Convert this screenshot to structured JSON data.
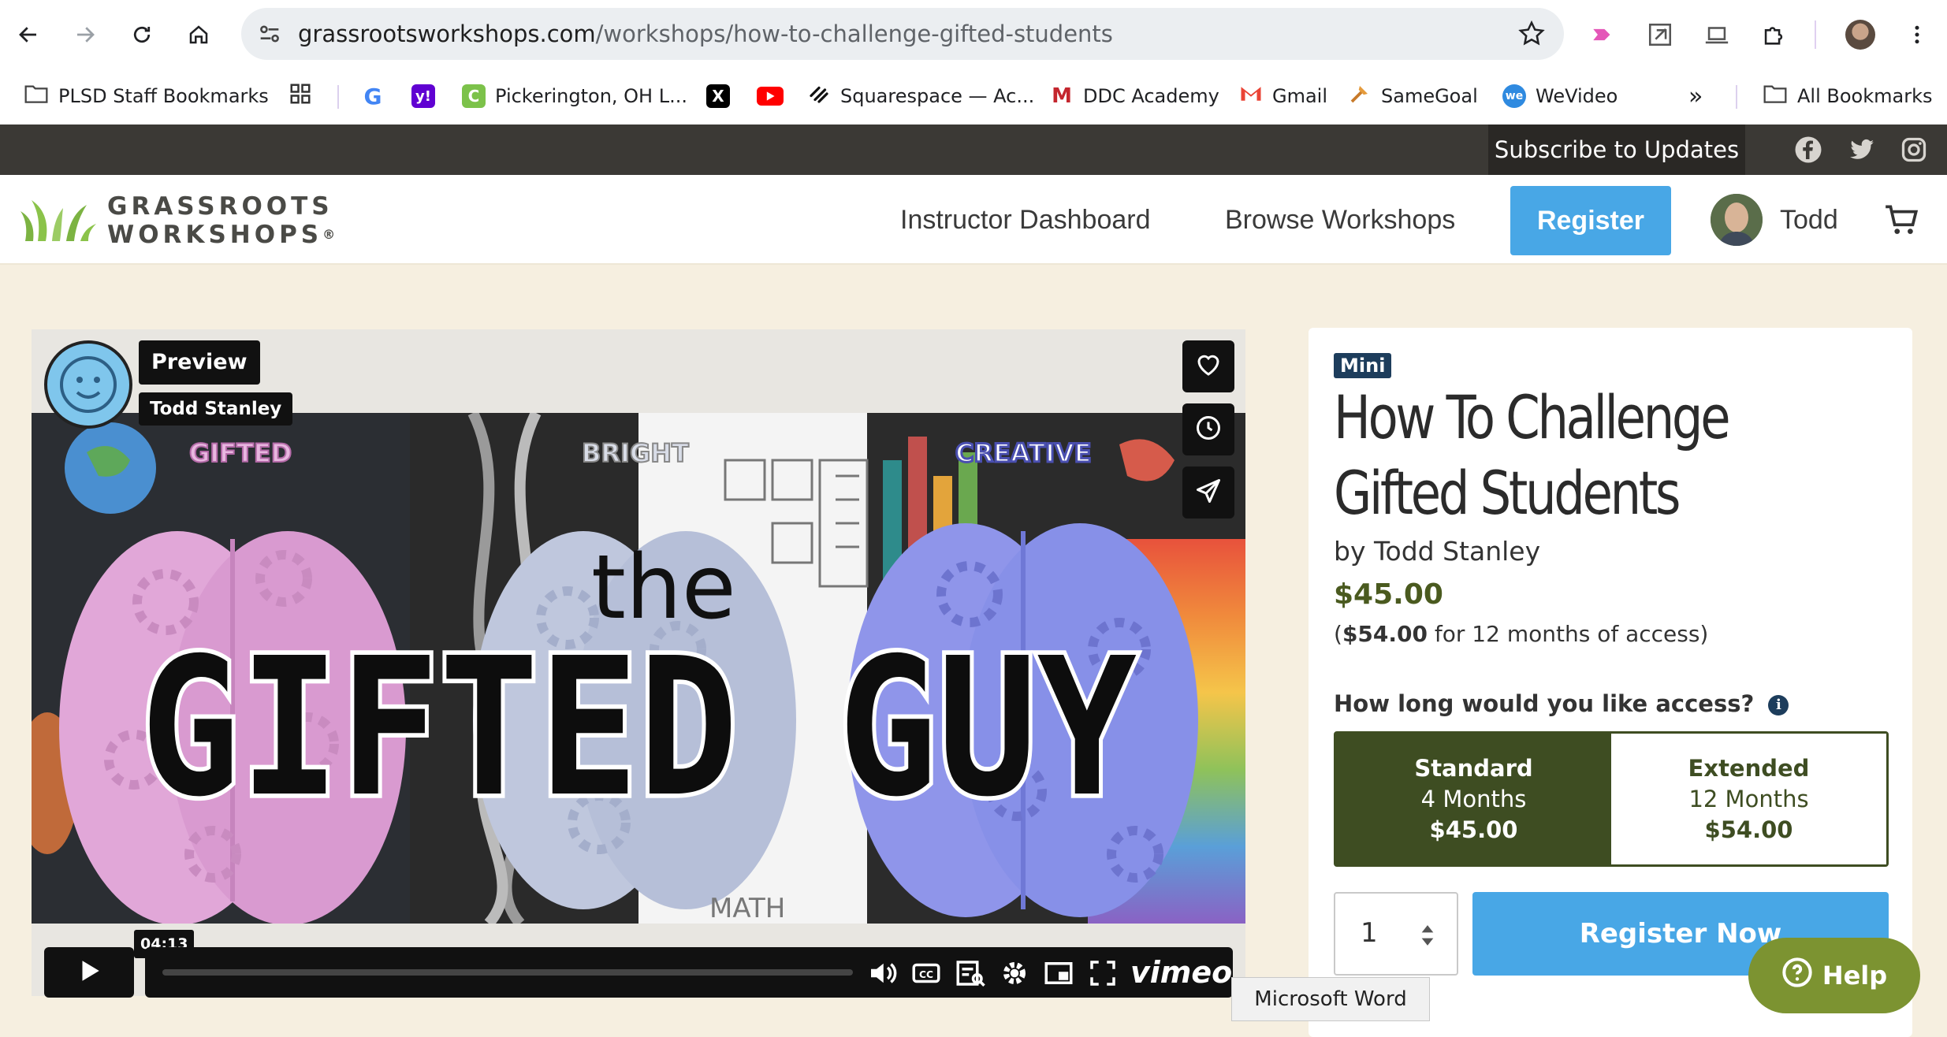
{
  "browser": {
    "url_domain": "grassrootsworkshops.com",
    "url_path": "/workshops/how-to-challenge-gifted-students",
    "nav_icons": [
      "back-arrow-icon",
      "forward-arrow-icon",
      "reload-icon",
      "home-icon"
    ],
    "bookmarks": [
      {
        "label": "PLSD Staff Bookmarks",
        "icon": "folder-icon"
      },
      {
        "label": "",
        "icon": "apps-grid-icon"
      },
      {
        "label": "",
        "icon": "google-icon"
      },
      {
        "label": "",
        "icon": "yahoo-icon"
      },
      {
        "label": "Pickerington, OH L...",
        "icon": "c-icon"
      },
      {
        "label": "",
        "icon": "x-icon"
      },
      {
        "label": "",
        "icon": "youtube-icon"
      },
      {
        "label": "Squarespace — Ac...",
        "icon": "squarespace-icon"
      },
      {
        "label": "DDC Academy",
        "icon": "m-icon"
      },
      {
        "label": "Gmail",
        "icon": "gmail-icon"
      },
      {
        "label": "SameGoal",
        "icon": "samegoal-icon"
      },
      {
        "label": "WeVideo",
        "icon": "wevideo-icon"
      }
    ],
    "more_bookmarks": "»",
    "all_bookmarks": "All Bookmarks"
  },
  "site": {
    "subscribe": "Subscribe to Updates",
    "logo_line1": "GRASSROOTS",
    "logo_line2": "WORKSHOPS",
    "logo_mark": "®",
    "nav": {
      "instructor_dashboard": "Instructor Dashboard",
      "browse_workshops": "Browse Workshops",
      "register": "Register",
      "user_name": "Todd"
    }
  },
  "video": {
    "preview_label": "Preview",
    "author_label": "Todd Stanley",
    "timestamp": "04:13",
    "art_words": {
      "gifted": "GIFTED",
      "bright": "BRIGHT",
      "creative": "CREATIVE",
      "the": "the",
      "main": "GIFTED GUY",
      "math": "MATH"
    },
    "brand": "vimeo"
  },
  "workshop": {
    "badge": "Mini",
    "title_line1": "How To Challenge",
    "title_line2": "Gifted Students",
    "byline": "by Todd Stanley",
    "price": "$45.00",
    "ext_price_bold": "$54.00",
    "ext_price_open": "(",
    "ext_price_rest": " for 12 months of access)",
    "access_question": "How long would you like access?",
    "plans": [
      {
        "name": "Standard",
        "duration": "4 Months",
        "price": "$45.00"
      },
      {
        "name": "Extended",
        "duration": "12 Months",
        "price": "$54.00"
      }
    ],
    "quantity": "1",
    "register_now": "Register Now"
  },
  "help_label": "Help",
  "tooltip": "Microsoft Word",
  "colors": {
    "accent_blue": "#48a7e6",
    "olive": "#3e4d22",
    "help_green": "#7c9331",
    "topbar": "#3b3935"
  }
}
